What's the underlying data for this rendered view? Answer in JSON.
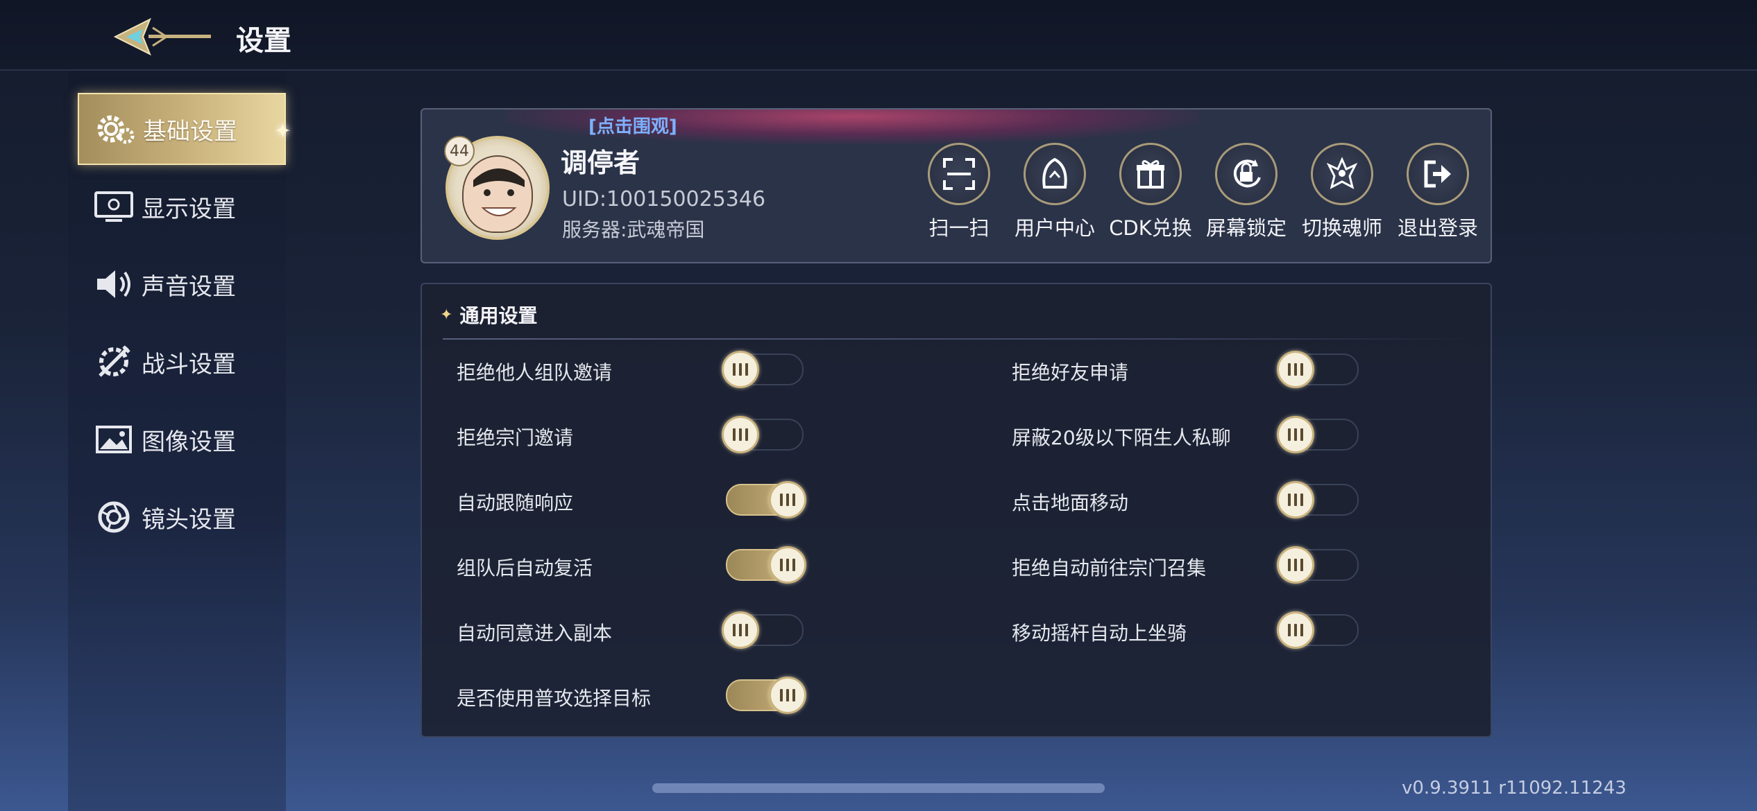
{
  "header": {
    "title": "设置"
  },
  "sidebar": {
    "items": [
      {
        "label": "基础设置",
        "icon": "gear-icon",
        "active": true
      },
      {
        "label": "显示设置",
        "icon": "monitor-icon",
        "active": false
      },
      {
        "label": "声音设置",
        "icon": "speaker-icon",
        "active": false
      },
      {
        "label": "战斗设置",
        "icon": "combat-icon",
        "active": false
      },
      {
        "label": "图像设置",
        "icon": "image-icon",
        "active": false
      },
      {
        "label": "镜头设置",
        "icon": "camera-lens-icon",
        "active": false
      }
    ]
  },
  "profile": {
    "banner_link": "[点击围观]",
    "level": "44",
    "name": "调停者",
    "uid": "UID:100150025346",
    "server": "服务器:武魂帝国",
    "actions": [
      {
        "label": "扫一扫",
        "icon": "scan-icon"
      },
      {
        "label": "用户中心",
        "icon": "user-center-icon"
      },
      {
        "label": "CDK兑换",
        "icon": "gift-icon"
      },
      {
        "label": "屏幕锁定",
        "icon": "lock-icon"
      },
      {
        "label": "切换魂师",
        "icon": "switch-character-icon"
      },
      {
        "label": "退出登录",
        "icon": "logout-icon"
      }
    ]
  },
  "general": {
    "title": "通用设置",
    "settings": [
      {
        "label": "拒绝他人组队邀请",
        "on": false
      },
      {
        "label": "拒绝好友申请",
        "on": false
      },
      {
        "label": "拒绝宗门邀请",
        "on": false
      },
      {
        "label": "屏蔽20级以下陌生人私聊",
        "on": false
      },
      {
        "label": "自动跟随响应",
        "on": true
      },
      {
        "label": "点击地面移动",
        "on": false
      },
      {
        "label": "组队后自动复活",
        "on": true
      },
      {
        "label": "拒绝自动前往宗门召集",
        "on": false
      },
      {
        "label": "自动同意进入副本",
        "on": false
      },
      {
        "label": "移动摇杆自动上坐骑",
        "on": false
      },
      {
        "label": "是否使用普攻选择目标",
        "on": true
      }
    ]
  },
  "footer": {
    "version": "v0.9.3911 r11092.11243"
  },
  "colors": {
    "accent_gold": "#c9b27c",
    "link_blue": "#7db1ff"
  }
}
